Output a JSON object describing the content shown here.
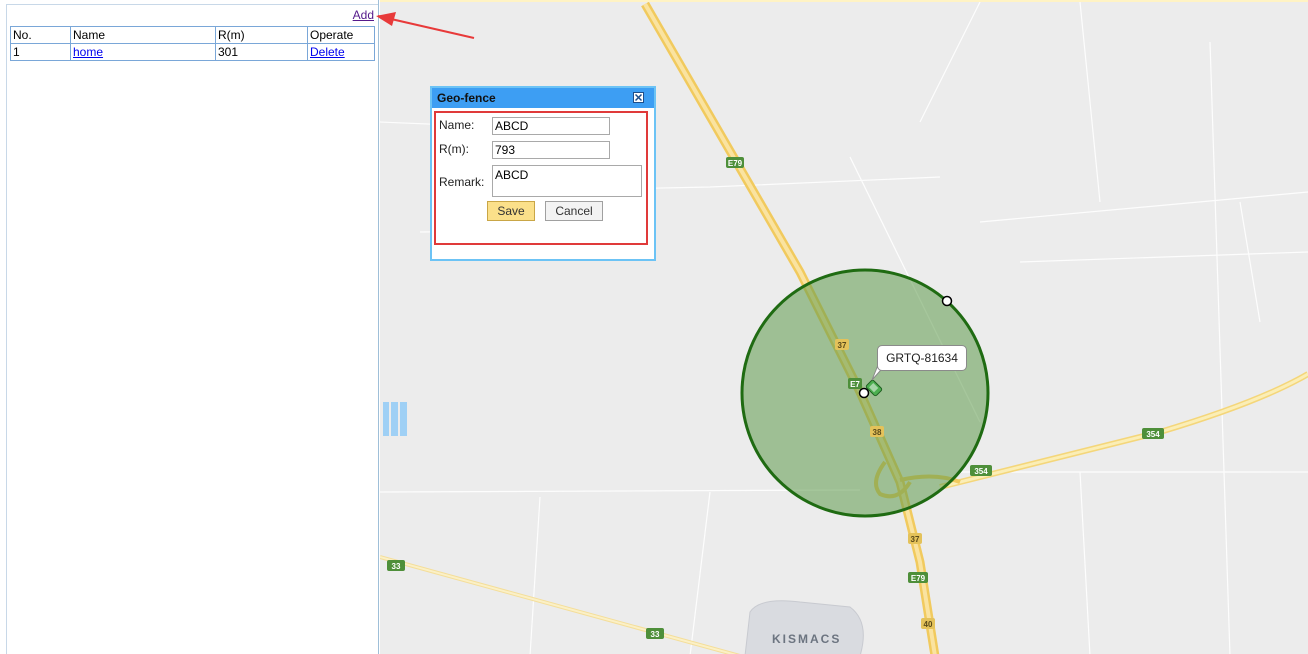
{
  "panel": {
    "add_label": "Add",
    "table": {
      "headers": [
        "No.",
        "Name",
        "R(m)",
        "Operate"
      ],
      "rows": [
        {
          "no": "1",
          "name": "home",
          "radius": "301",
          "operate": "Delete"
        }
      ]
    }
  },
  "dialog": {
    "title": "Geo-fence",
    "name_label": "Name:",
    "name_value": "ABCD",
    "radius_label": "R(m):",
    "radius_value": "793",
    "remark_label": "Remark:",
    "remark_value": "ABCD",
    "save_label": "Save",
    "cancel_label": "Cancel"
  },
  "map": {
    "vehicle_label": "GRTQ-81634",
    "place_label": "KISMACS",
    "road_shields": {
      "e79_top": "E79",
      "n37_a": "37",
      "e79_mid": "E7",
      "n38": "38",
      "n354_a": "354",
      "n354_b": "354",
      "n37_b": "37",
      "e79_bottom": "E79",
      "n33_a": "33",
      "n33_b": "33",
      "n40": "40"
    },
    "colors": {
      "fence_fill": "#5e9a4d",
      "fence_stroke": "#1f6b12",
      "highway": "#f6d77a",
      "annotation_arrow": "#e83a3a"
    },
    "icons": {
      "vehicle": "car-icon",
      "handle": "resize-handle-icon",
      "close": "close-icon"
    }
  }
}
